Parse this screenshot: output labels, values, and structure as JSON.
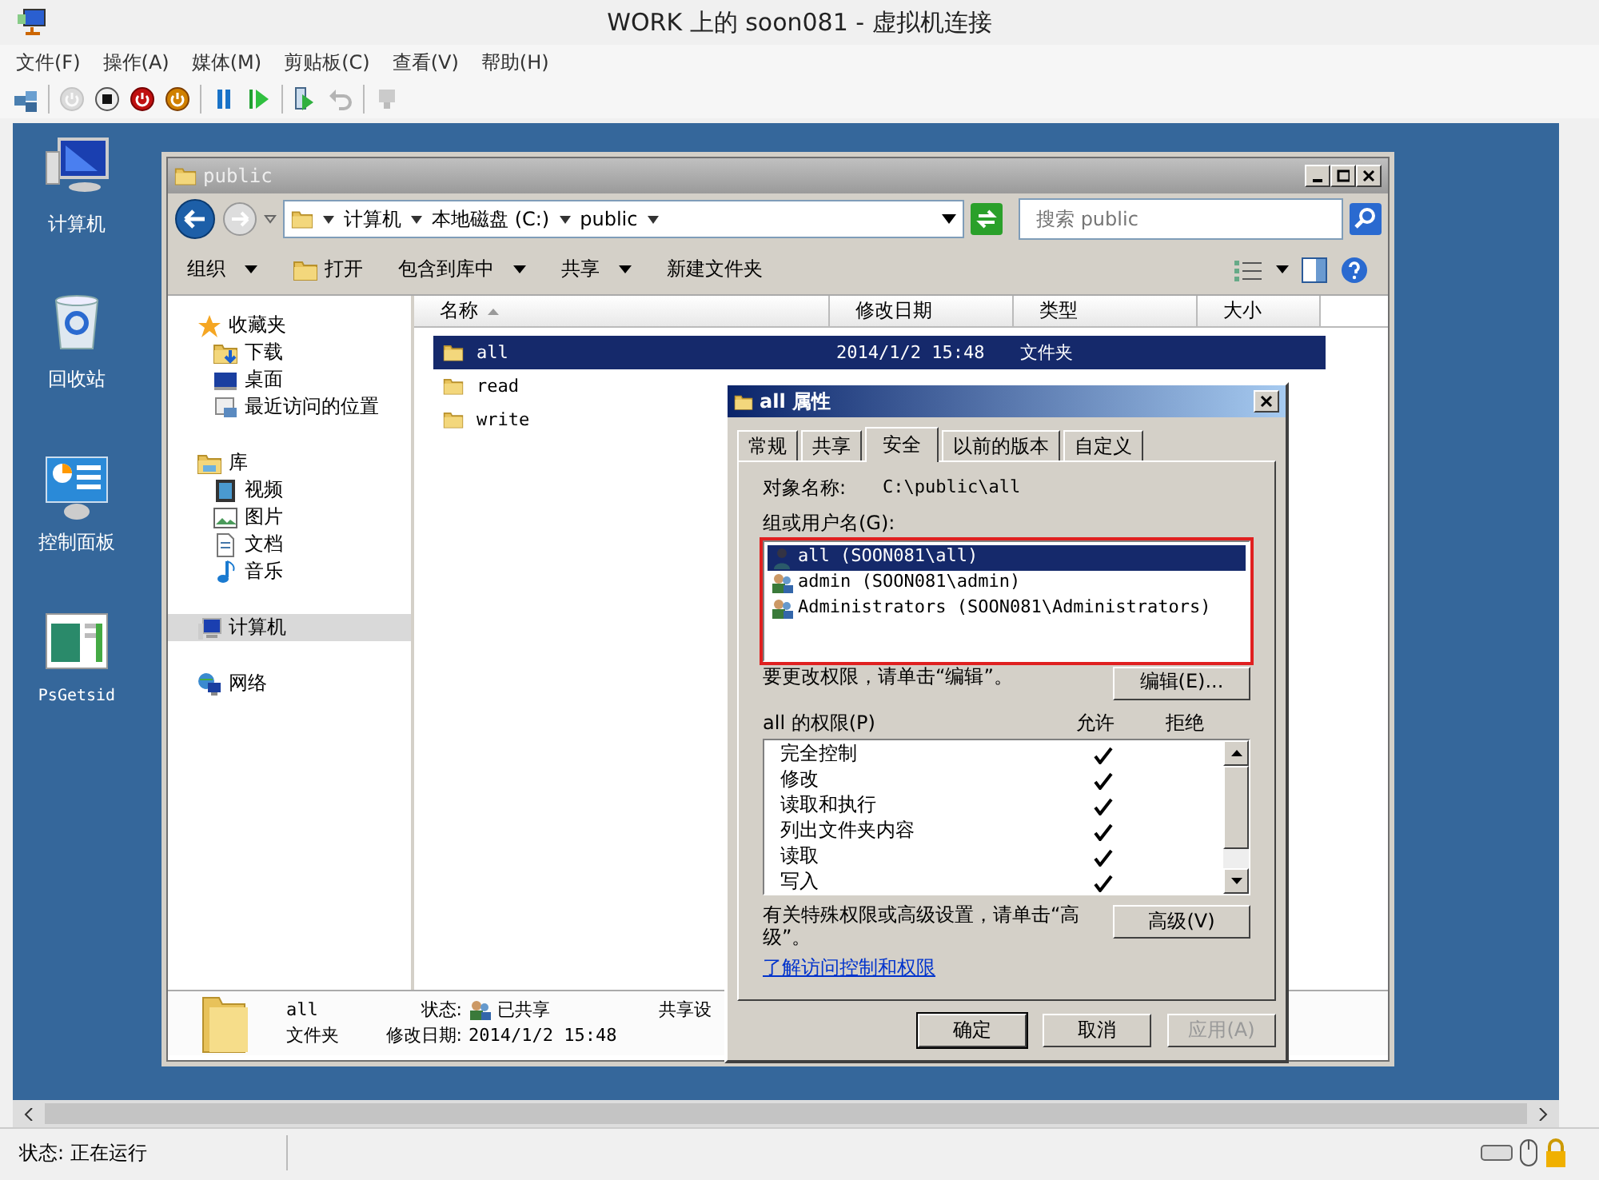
{
  "window": {
    "title": "WORK 上的 soon081 - 虚拟机连接"
  },
  "menu": [
    {
      "label": "文件(F)"
    },
    {
      "label": "操作(A)"
    },
    {
      "label": "媒体(M)"
    },
    {
      "label": "剪贴板(C)"
    },
    {
      "label": "查看(V)"
    },
    {
      "label": "帮助(H)"
    }
  ],
  "toolbar": [
    {
      "kind": "ctrl-alt-del",
      "disabled": false
    },
    {
      "kind": "start",
      "disabled": true
    },
    {
      "kind": "turn-off",
      "disabled": false
    },
    {
      "kind": "shut-down",
      "disabled": false
    },
    {
      "kind": "save",
      "disabled": false
    },
    {
      "kind": "pause",
      "disabled": false
    },
    {
      "kind": "reset",
      "disabled": false
    },
    {
      "kind": "checkpoint",
      "disabled": false
    },
    {
      "kind": "revert",
      "disabled": true
    },
    {
      "kind": "enhanced",
      "disabled": true
    }
  ],
  "desktop_icons": [
    {
      "label": "计算机",
      "kind": "computer"
    },
    {
      "label": "回收站",
      "kind": "recycle"
    },
    {
      "label": "控制面板",
      "kind": "control-panel"
    },
    {
      "label": "PsGetsid",
      "kind": "app"
    }
  ],
  "explorer": {
    "title": "public",
    "breadcrumb": [
      "计算机",
      "本地磁盘 (C:)",
      "public"
    ],
    "search": {
      "placeholder": "搜索 public"
    },
    "commands": [
      {
        "label": "组织",
        "icon": false,
        "dropdown": true
      },
      {
        "label": "打开",
        "icon": true,
        "dropdown": false
      },
      {
        "label": "包含到库中",
        "icon": false,
        "dropdown": true
      },
      {
        "label": "共享",
        "icon": false,
        "dropdown": true
      },
      {
        "label": "新建文件夹",
        "icon": false,
        "dropdown": false
      }
    ],
    "nav": [
      {
        "label": "收藏夹",
        "kind": "star",
        "selected": false,
        "children": [
          {
            "label": "下载",
            "kind": "download",
            "selected": false
          },
          {
            "label": "桌面",
            "kind": "desktop",
            "selected": false
          },
          {
            "label": "最近访问的位置",
            "kind": "recent",
            "selected": false
          }
        ]
      },
      {
        "label": "库",
        "kind": "library",
        "selected": false,
        "children": [
          {
            "label": "视频",
            "kind": "video",
            "selected": false
          },
          {
            "label": "图片",
            "kind": "image",
            "selected": false
          },
          {
            "label": "文档",
            "kind": "document",
            "selected": false
          },
          {
            "label": "音乐",
            "kind": "music",
            "selected": false
          }
        ]
      },
      {
        "label": "计算机",
        "kind": "computer",
        "selected": true
      },
      {
        "label": "网络",
        "kind": "network",
        "selected": false
      }
    ],
    "columns": [
      "名称",
      "修改日期",
      "类型",
      "大小"
    ],
    "files": [
      {
        "name": "all",
        "date": "2014/1/2 15:48",
        "type": "文件夹",
        "selected": true
      },
      {
        "name": "read",
        "selected": false
      },
      {
        "name": "write",
        "selected": false
      }
    ],
    "details": {
      "name": "all",
      "type": "文件夹",
      "status_label": "状态:",
      "status": "已共享",
      "date_label": "修改日期:",
      "date": "2014/1/2 15:48",
      "extra": "共享设"
    }
  },
  "dialog": {
    "title": "all 属性",
    "tabs": [
      {
        "label": "常规",
        "selected": false
      },
      {
        "label": "共享",
        "selected": false
      },
      {
        "label": "安全",
        "selected": true
      },
      {
        "label": "以前的版本",
        "selected": false
      },
      {
        "label": "自定义",
        "selected": false
      }
    ],
    "object_label": "对象名称:",
    "object_value": "C:\\public\\all",
    "groups_label": "组或用户名(G):",
    "users": [
      {
        "name": "all  (SOON081\\all)",
        "kind": "user",
        "selected": true
      },
      {
        "name": "admin  (SOON081\\admin)",
        "kind": "group",
        "selected": false
      },
      {
        "name": "Administrators  (SOON081\\Administrators)",
        "kind": "group",
        "selected": false
      }
    ],
    "edit_note": "要更改权限，请单击“编辑”。",
    "edit_button": "编辑(E)...",
    "perm_label": "all 的权限(P)",
    "allow_label": "允许",
    "deny_label": "拒绝",
    "permissions": [
      {
        "name": "完全控制",
        "allow": true,
        "deny": false
      },
      {
        "name": "修改",
        "allow": true,
        "deny": false
      },
      {
        "name": "读取和执行",
        "allow": true,
        "deny": false
      },
      {
        "name": "列出文件夹内容",
        "allow": true,
        "deny": false
      },
      {
        "name": "读取",
        "allow": true,
        "deny": false
      },
      {
        "name": "写入",
        "allow": true,
        "deny": false
      }
    ],
    "advanced_note": "有关特殊权限或高级设置，请单击“高级”。",
    "advanced_button": "高级(V)",
    "link": "了解访问控制和权限",
    "buttons": [
      {
        "label": "确定",
        "disabled": false,
        "default": true
      },
      {
        "label": "取消",
        "disabled": false,
        "default": false
      },
      {
        "label": "应用(A)",
        "disabled": true,
        "default": false
      }
    ]
  },
  "status_bar": {
    "text": "状态: 正在运行"
  }
}
